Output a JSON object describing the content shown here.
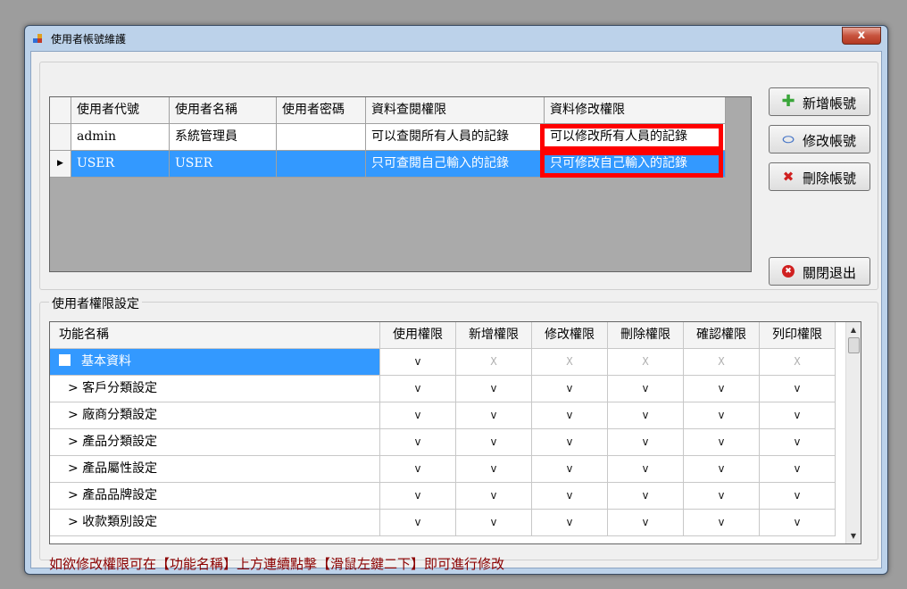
{
  "window": {
    "title": "使用者帳號維護",
    "close_label": "x",
    "accent": "#3399ff",
    "highlight_border": "#ff0000"
  },
  "users_grid": {
    "columns": [
      "使用者代號",
      "使用者名稱",
      "使用者密碼",
      "資料查閱權限",
      "資料修改權限"
    ],
    "rows": [
      {
        "selected": false,
        "indicator": "",
        "id": "admin",
        "name": "系統管理員",
        "password": "",
        "view": "可以查閱所有人員的記錄",
        "edit": "可以修改所有人員的記錄"
      },
      {
        "selected": true,
        "indicator": "▶",
        "id": "USER",
        "name": "USER",
        "password": "",
        "view": "只可查閱自己輸入的記錄",
        "edit": "只可修改自己輸入的記錄"
      }
    ]
  },
  "actions": {
    "add": {
      "label": "新增帳號",
      "icon": "plus-icon"
    },
    "edit": {
      "label": "修改帳號",
      "icon": "eraser-icon"
    },
    "delete": {
      "label": "刪除帳號",
      "icon": "delete-x-icon"
    },
    "close": {
      "label": "關閉退出",
      "icon": "close-circle-icon"
    }
  },
  "permissions": {
    "group_label": "使用者權限設定",
    "columns": [
      "功能名稱",
      "使用權限",
      "新增權限",
      "修改權限",
      "刪除權限",
      "確認權限",
      "列印權限"
    ],
    "rows": [
      {
        "name": "基本資料",
        "selected": true,
        "cells": [
          "v",
          "X",
          "X",
          "X",
          "X",
          "X"
        ]
      },
      {
        "name": "> 客戶分類設定",
        "selected": false,
        "cells": [
          "v",
          "v",
          "v",
          "v",
          "v",
          "v"
        ]
      },
      {
        "name": "> 廠商分類設定",
        "selected": false,
        "cells": [
          "v",
          "v",
          "v",
          "v",
          "v",
          "v"
        ]
      },
      {
        "name": "> 產品分類設定",
        "selected": false,
        "cells": [
          "v",
          "v",
          "v",
          "v",
          "v",
          "v"
        ]
      },
      {
        "name": "> 產品屬性設定",
        "selected": false,
        "cells": [
          "v",
          "v",
          "v",
          "v",
          "v",
          "v"
        ]
      },
      {
        "name": "> 產品品牌設定",
        "selected": false,
        "cells": [
          "v",
          "v",
          "v",
          "v",
          "v",
          "v"
        ]
      },
      {
        "name": "> 收款類別設定",
        "selected": false,
        "cells": [
          "v",
          "v",
          "v",
          "v",
          "v",
          "v"
        ]
      }
    ],
    "scroll_up": "▲",
    "scroll_down": "▼"
  },
  "hint_text": "如欲修改權限可在【功能名稱】上方連續點擊【滑鼠左鍵二下】即可進行修改"
}
